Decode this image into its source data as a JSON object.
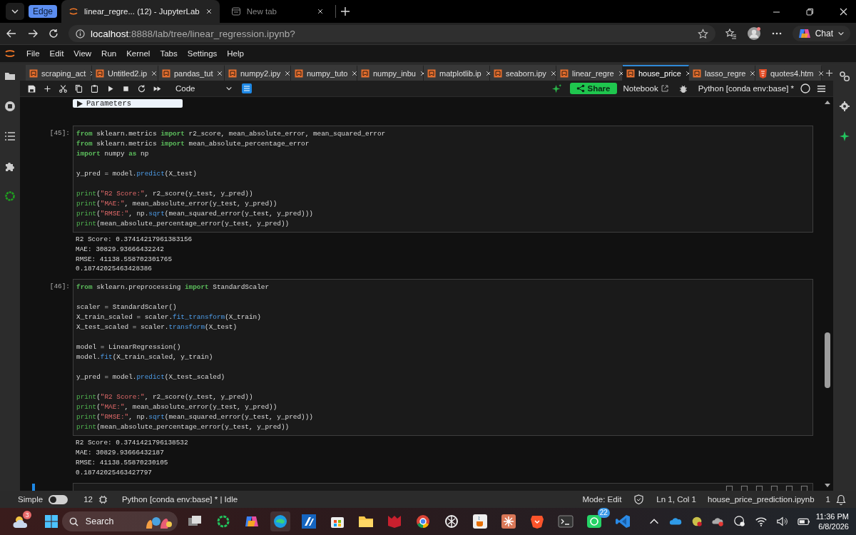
{
  "browser": {
    "badge": "Edge",
    "tabs": [
      {
        "title": "linear_regre... (12) - JupyterLab",
        "selected": true
      },
      {
        "title": "New tab",
        "selected": false
      }
    ],
    "url_host": "localhost",
    "url_rest": ":8888/lab/tree/linear_regression.ipynb?",
    "chat": "Chat"
  },
  "menu": [
    "File",
    "Edit",
    "View",
    "Run",
    "Kernel",
    "Tabs",
    "Settings",
    "Help"
  ],
  "doc_tabs": [
    {
      "label": "scraping_act",
      "kind": "notebook",
      "selected": false
    },
    {
      "label": "Untitled2.ip",
      "kind": "notebook",
      "selected": false
    },
    {
      "label": "pandas_tut",
      "kind": "notebook",
      "selected": false
    },
    {
      "label": "numpy2.ipy",
      "kind": "notebook",
      "selected": false
    },
    {
      "label": "numpy_tuto",
      "kind": "notebook",
      "selected": false
    },
    {
      "label": "numpy_inbu",
      "kind": "notebook",
      "selected": false
    },
    {
      "label": "matplotlib.ip",
      "kind": "notebook",
      "selected": false
    },
    {
      "label": "seaborn.ipy",
      "kind": "notebook",
      "selected": false
    },
    {
      "label": "linear_regre",
      "kind": "notebook",
      "selected": false
    },
    {
      "label": "house_price",
      "kind": "notebook",
      "selected": true
    },
    {
      "label": "lasso_regre",
      "kind": "notebook",
      "selected": false
    },
    {
      "label": "quotes4.htm",
      "kind": "html",
      "selected": false
    }
  ],
  "toolbar": {
    "cell_type": "Code",
    "share": "Share",
    "notebook": "Notebook",
    "kernel": "Python [conda env:base] *"
  },
  "parameters": "Parameters",
  "cells": [
    {
      "prompt": "[45]:",
      "lines": [
        {
          "kind": "code",
          "tokens": [
            {
              "kind": "keyword",
              "text": "from"
            },
            {
              "kind": "plain",
              "text": " sklearn.metrics "
            },
            {
              "kind": "keyword",
              "text": "import"
            },
            {
              "kind": "plain",
              "text": " r2_score, mean_absolute_error, mean_squared_error"
            }
          ]
        },
        {
          "kind": "code",
          "tokens": [
            {
              "kind": "keyword",
              "text": "from"
            },
            {
              "kind": "plain",
              "text": " sklearn.metrics "
            },
            {
              "kind": "keyword",
              "text": "import"
            },
            {
              "kind": "plain",
              "text": " mean_absolute_percentage_error"
            }
          ]
        },
        {
          "kind": "code",
          "tokens": [
            {
              "kind": "keyword",
              "text": "import"
            },
            {
              "kind": "plain",
              "text": " numpy "
            },
            {
              "kind": "keyword",
              "text": "as"
            },
            {
              "kind": "plain",
              "text": " np"
            }
          ]
        },
        {
          "kind": "blank"
        },
        {
          "kind": "code",
          "tokens": [
            {
              "kind": "plain",
              "text": "y_pred = model."
            },
            {
              "kind": "function",
              "text": "predict"
            },
            {
              "kind": "plain",
              "text": "(X_test)"
            }
          ]
        },
        {
          "kind": "blank"
        },
        {
          "kind": "code",
          "tokens": [
            {
              "kind": "builtin",
              "text": "print"
            },
            {
              "kind": "plain",
              "text": "("
            },
            {
              "kind": "string",
              "text": "\"R2 Score:\""
            },
            {
              "kind": "plain",
              "text": ", r2_score(y_test, y_pred))"
            }
          ]
        },
        {
          "kind": "code",
          "tokens": [
            {
              "kind": "builtin",
              "text": "print"
            },
            {
              "kind": "plain",
              "text": "("
            },
            {
              "kind": "string",
              "text": "\"MAE:\""
            },
            {
              "kind": "plain",
              "text": ", mean_absolute_error(y_test, y_pred))"
            }
          ]
        },
        {
          "kind": "code",
          "tokens": [
            {
              "kind": "builtin",
              "text": "print"
            },
            {
              "kind": "plain",
              "text": "("
            },
            {
              "kind": "string",
              "text": "\"RMSE:\""
            },
            {
              "kind": "plain",
              "text": ", np."
            },
            {
              "kind": "function",
              "text": "sqrt"
            },
            {
              "kind": "plain",
              "text": "(mean_squared_error(y_test, y_pred)))"
            }
          ]
        },
        {
          "kind": "code",
          "tokens": [
            {
              "kind": "builtin",
              "text": "print"
            },
            {
              "kind": "plain",
              "text": "(mean_absolute_percentage_error(y_test, y_pred))"
            }
          ]
        }
      ],
      "output": [
        "R2 Score: 0.37414217961383156",
        "MAE: 30829.93666432242",
        "RMSE: 41138.558702301765",
        "0.18742025463428386"
      ]
    },
    {
      "prompt": "[46]:",
      "lines": [
        {
          "kind": "code",
          "tokens": [
            {
              "kind": "keyword",
              "text": "from"
            },
            {
              "kind": "plain",
              "text": " sklearn.preprocessing "
            },
            {
              "kind": "keyword",
              "text": "import"
            },
            {
              "kind": "plain",
              "text": " StandardScaler"
            }
          ]
        },
        {
          "kind": "blank"
        },
        {
          "kind": "code",
          "tokens": [
            {
              "kind": "plain",
              "text": "scaler = StandardScaler()"
            }
          ]
        },
        {
          "kind": "code",
          "tokens": [
            {
              "kind": "plain",
              "text": "X_train_scaled = scaler."
            },
            {
              "kind": "function",
              "text": "fit_transform"
            },
            {
              "kind": "plain",
              "text": "(X_train)"
            }
          ]
        },
        {
          "kind": "code",
          "tokens": [
            {
              "kind": "plain",
              "text": "X_test_scaled = scaler."
            },
            {
              "kind": "function",
              "text": "transform"
            },
            {
              "kind": "plain",
              "text": "(X_test)"
            }
          ]
        },
        {
          "kind": "blank"
        },
        {
          "kind": "code",
          "tokens": [
            {
              "kind": "plain",
              "text": "model = LinearRegression()"
            }
          ]
        },
        {
          "kind": "code",
          "tokens": [
            {
              "kind": "plain",
              "text": "model."
            },
            {
              "kind": "function",
              "text": "fit"
            },
            {
              "kind": "plain",
              "text": "(X_train_scaled, y_train)"
            }
          ]
        },
        {
          "kind": "blank"
        },
        {
          "kind": "code",
          "tokens": [
            {
              "kind": "plain",
              "text": "y_pred = model."
            },
            {
              "kind": "function",
              "text": "predict"
            },
            {
              "kind": "plain",
              "text": "(X_test_scaled)"
            }
          ]
        },
        {
          "kind": "blank"
        },
        {
          "kind": "code",
          "tokens": [
            {
              "kind": "builtin",
              "text": "print"
            },
            {
              "kind": "plain",
              "text": "("
            },
            {
              "kind": "string",
              "text": "\"R2 Score:\""
            },
            {
              "kind": "plain",
              "text": ", r2_score(y_test, y_pred))"
            }
          ]
        },
        {
          "kind": "code",
          "tokens": [
            {
              "kind": "builtin",
              "text": "print"
            },
            {
              "kind": "plain",
              "text": "("
            },
            {
              "kind": "string",
              "text": "\"MAE:\""
            },
            {
              "kind": "plain",
              "text": ", mean_absolute_error(y_test, y_pred))"
            }
          ]
        },
        {
          "kind": "code",
          "tokens": [
            {
              "kind": "builtin",
              "text": "print"
            },
            {
              "kind": "plain",
              "text": "("
            },
            {
              "kind": "string",
              "text": "\"RMSE:\""
            },
            {
              "kind": "plain",
              "text": ", np."
            },
            {
              "kind": "function",
              "text": "sqrt"
            },
            {
              "kind": "plain",
              "text": "(mean_squared_error(y_test, y_pred)))"
            }
          ]
        },
        {
          "kind": "code",
          "tokens": [
            {
              "kind": "builtin",
              "text": "print"
            },
            {
              "kind": "plain",
              "text": "(mean_absolute_percentage_error(y_test, y_pred))"
            }
          ]
        }
      ],
      "output": [
        "R2 Score: 0.3741421796138532",
        "MAE: 30829.93666432187",
        "RMSE: 41138.55870230105",
        "0.18742025463427797"
      ]
    }
  ],
  "status": {
    "simple": "Simple",
    "simple_on": false,
    "count": "12",
    "kernel": "Python [conda env:base] * | Idle",
    "mode": "Mode: Edit",
    "position": "Ln 1, Col 1",
    "file": "house_price_prediction.ipynb",
    "notifications": "1"
  },
  "taskbar": {
    "weather_badge": "3",
    "search": "Search",
    "whatsapp_badge": "22",
    "time": "11:36 PM",
    "date": "6/8/2026"
  }
}
